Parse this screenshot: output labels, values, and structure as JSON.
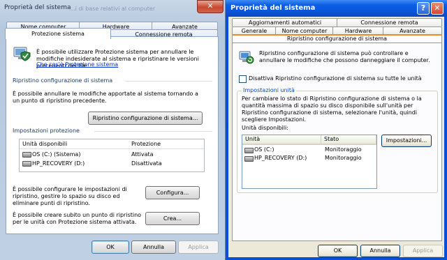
{
  "left": {
    "title": "Proprietà del sistema",
    "close": "✕",
    "background_text": "...i di base relativi al computer",
    "tabs_row1": [
      "Nome computer",
      "Hardware",
      "Avanzate"
    ],
    "tabs_row2": [
      "Protezione sistema",
      "Connessione remota"
    ],
    "intro": "È possibile utilizzare Protezione sistema per annullare le modifiche indesiderate al sistema e ripristinare le versioni precedenti dei file.",
    "link": "Che cos'è Protezione sistema",
    "restore_group": "Ripristino configurazione di sistema",
    "restore_text": "È possibile annullare le modifiche apportate al sistema tornando a un punto di ripristino precedente.",
    "restore_button": "Ripristino configurazione di sistema...",
    "settings_group": "Impostazioni protezione",
    "table": {
      "headers": [
        "Unità disponibili",
        "Protezione"
      ],
      "rows": [
        {
          "drive": "OS (C:) (Sistema)",
          "status": "Attivata",
          "icon": "system-drive-icon"
        },
        {
          "drive": "HP_RECOVERY (D:)",
          "status": "Disattivata",
          "icon": "drive-icon"
        }
      ]
    },
    "configure_text": "È possibile configurare le impostazioni di ripristino, gestire lo spazio su disco ed eliminare punti di ripristino.",
    "configure_button": "Configura...",
    "create_text": "È possibile creare subito un punto di ripristino per le unità con Protezione sistema attivata.",
    "create_button": "Crea...",
    "ok": "OK",
    "cancel": "Annulla",
    "apply": "Applica"
  },
  "right": {
    "title": "Proprietà del sistema",
    "help": "?",
    "close": "✕",
    "tabs_row1": [
      "Aggiornamenti automatici",
      "Connessione remota"
    ],
    "tabs_row2": [
      "Generale",
      "Nome computer",
      "Hardware",
      "Avanzate"
    ],
    "tabs_row3": [
      "Ripristino configurazione di sistema"
    ],
    "intro": "Ripristino configurazione di sistema può controllare e annullare le modifiche che possono danneggiare il computer.",
    "checkbox_label": "Disattiva Ripristino configurazione di sistema su tutte le unità",
    "group_label": "Impostazioni unità",
    "group_text": "Per cambiare lo stato di Ripristino configurazione di sistema o la quantità massima di spazio su disco disponibile sull'unità per Ripristino configurazione di sistema, selezionare l'unità, quindi scegliere Impostazioni.",
    "drives_label": "Unità disponibili:",
    "table": {
      "headers": [
        "Unità",
        "Stato"
      ],
      "rows": [
        {
          "drive": "OS (C:)",
          "status": "Monitoraggio"
        },
        {
          "drive": "HP_RECOVERY (D:)",
          "status": "Monitoraggio"
        }
      ]
    },
    "settings_button": "Impostazioni...",
    "ok": "OK",
    "cancel": "Annulla",
    "apply": "Applica"
  },
  "colors": {
    "xp_titlebar": "#0a55d9",
    "xp_close": "#d8462f",
    "vista_frame": "#bfd0e4",
    "link": "#0033cc",
    "group_label": "#0046d5"
  }
}
